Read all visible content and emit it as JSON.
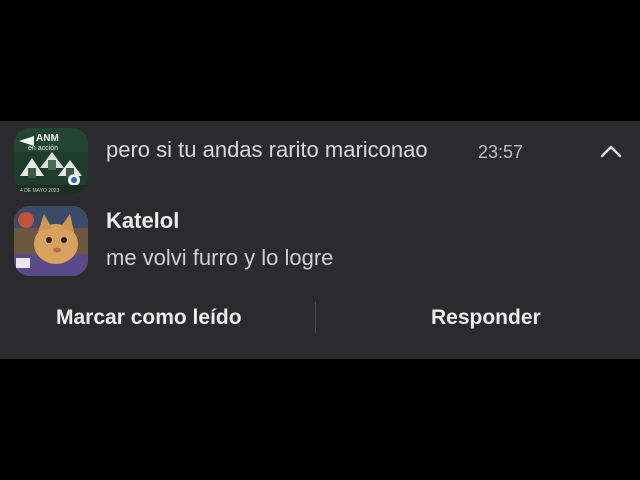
{
  "notification": {
    "conversation_title": "pero si tu andas rarito mariconao",
    "timestamp": "23:57",
    "collapse_icon": "chevron-up-icon",
    "group_avatar": {
      "logo_text": "ANM",
      "logo_subtext": "en acción",
      "footer_text": "4 DE MAYO 2023"
    },
    "message": {
      "sender": "Katelol",
      "text": "me volvi furro y lo logre"
    },
    "actions": {
      "mark_read": "Marcar como leído",
      "reply": "Responder"
    }
  }
}
